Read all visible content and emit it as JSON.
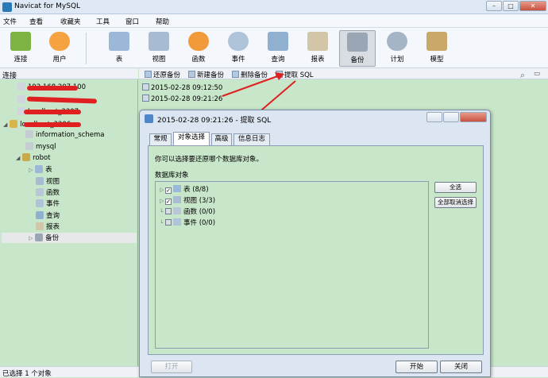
{
  "window": {
    "title": "Navicat for MySQL",
    "controls": [
      "minimize-icon",
      "maximize-icon",
      "close-icon"
    ]
  },
  "menu": [
    "文件",
    "查看",
    "收藏夹",
    "工具",
    "窗口",
    "帮助"
  ],
  "toolbar": [
    {
      "label": "连接",
      "icon": "connection-plug-icon",
      "color": "#7cb342"
    },
    {
      "label": "用户",
      "icon": "user-icon",
      "color": "#f4a340"
    },
    {
      "label": "表",
      "icon": "table-icon",
      "color": "#9bb8d8"
    },
    {
      "label": "视图",
      "icon": "view-icon",
      "color": "#a7bcd3"
    },
    {
      "label": "函数",
      "icon": "function-icon",
      "color": "#f29a3a"
    },
    {
      "label": "事件",
      "icon": "event-clock-icon",
      "color": "#b0c4d9"
    },
    {
      "label": "查询",
      "icon": "query-icon",
      "color": "#8fb1cf"
    },
    {
      "label": "报表",
      "icon": "report-icon",
      "color": "#d3c6a8"
    },
    {
      "label": "备份",
      "icon": "backup-icon",
      "color": "#9aa6b3",
      "active": true
    },
    {
      "label": "计划",
      "icon": "schedule-icon",
      "color": "#a5b5c6"
    },
    {
      "label": "模型",
      "icon": "model-icon",
      "color": "#c9a86a"
    }
  ],
  "left_header": "连接",
  "tree": [
    {
      "label": "192.168.207.100",
      "level": 1,
      "icon": "server-icon",
      "redacted": true
    },
    {
      "label": "",
      "level": 1,
      "icon": "server-icon",
      "redacted": true
    },
    {
      "label": "localhost_3307",
      "level": 1,
      "icon": "server-icon",
      "redacted": true
    },
    {
      "label": "localhost_3306",
      "level": 0,
      "icon": "server-connected-icon",
      "redacted": true
    },
    {
      "label": "information_schema",
      "level": 1,
      "icon": "database-icon"
    },
    {
      "label": "mysql",
      "level": 1,
      "icon": "database-icon"
    },
    {
      "label": "robot",
      "level": 1,
      "icon": "database-open-icon"
    },
    {
      "label": "表",
      "level": 2,
      "icon": "table-icon"
    },
    {
      "label": "视图",
      "level": 2,
      "icon": "view-icon"
    },
    {
      "label": "函数",
      "level": 2,
      "icon": "function-icon"
    },
    {
      "label": "事件",
      "level": 2,
      "icon": "event-icon"
    },
    {
      "label": "查询",
      "level": 2,
      "icon": "query-icon"
    },
    {
      "label": "报表",
      "level": 2,
      "icon": "report-icon"
    },
    {
      "label": "备份",
      "level": 2,
      "icon": "backup-icon",
      "selected": true
    }
  ],
  "object_toolbar": [
    "还原备份",
    "新建备份",
    "删除备份",
    "提取 SQL"
  ],
  "backups": [
    "2015-02-28 09:12:50",
    "2015-02-28 09:21:26"
  ],
  "status": "已选择 1 个对象",
  "search_icon": "search-icon",
  "dialog": {
    "title": "2015-02-28 09:21:26 - 提取 SQL",
    "tabs": [
      "常规",
      "对象选择",
      "高级",
      "信息日志"
    ],
    "active_tab": 1,
    "hint": "你可以选择要还原哪个数据库对象。",
    "group_label": "数据库对象",
    "objects": [
      {
        "label": "表 (8/8)",
        "checked": true,
        "expandable": true,
        "icon": "table-icon"
      },
      {
        "label": "视图 (3/3)",
        "checked": true,
        "expandable": true,
        "icon": "view-icon"
      },
      {
        "label": "函数 (0/0)",
        "checked": false,
        "expandable": false,
        "icon": "function-icon"
      },
      {
        "label": "事件 (0/0)",
        "checked": false,
        "expandable": false,
        "icon": "event-icon"
      }
    ],
    "select_all": "全选",
    "deselect_all": "全部取消选择",
    "open": "打开",
    "start": "开始",
    "close": "关闭"
  }
}
